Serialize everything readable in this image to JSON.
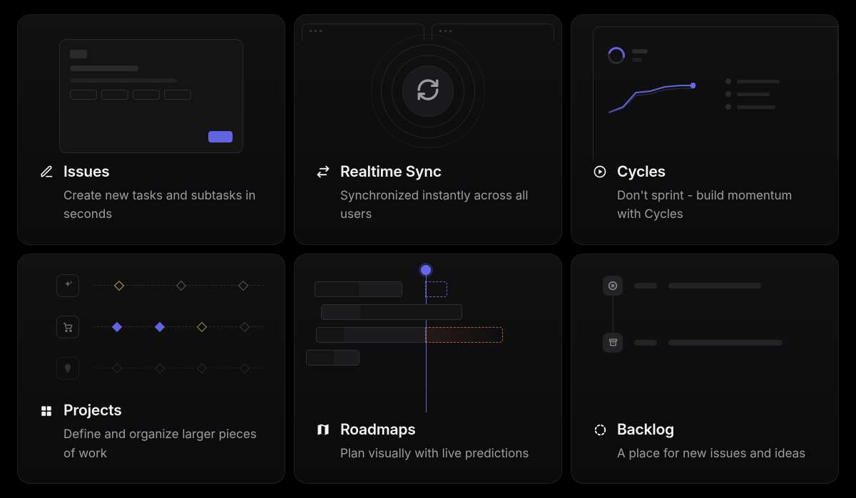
{
  "cards": {
    "issues": {
      "title": "Issues",
      "desc": "Create new tasks and subtasks in seconds"
    },
    "sync": {
      "title": "Realtime Sync",
      "desc": "Synchronized instantly across all users"
    },
    "cycles": {
      "title": "Cycles",
      "desc": "Don't sprint - build momentum with Cycles"
    },
    "projects": {
      "title": "Projects",
      "desc": "Define and organize larger pieces of work"
    },
    "roadmaps": {
      "title": "Roadmaps",
      "desc": "Plan visually with live predictions"
    },
    "backlog": {
      "title": "Backlog",
      "desc": "A place for new issues and ideas"
    }
  },
  "colors": {
    "accent": "#6265e3",
    "amber": "#bfa23a",
    "orange": "#c77f52"
  }
}
